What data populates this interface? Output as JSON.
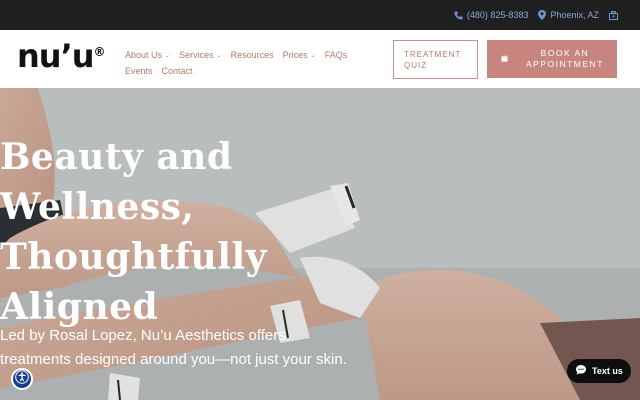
{
  "topbar": {
    "phone": "(480) 825-8383",
    "location": "Phoenix, AZ"
  },
  "brand": {
    "logo": "nu’u"
  },
  "nav": {
    "items": [
      {
        "label": "About Us",
        "has_dropdown": true
      },
      {
        "label": "Services",
        "has_dropdown": true
      },
      {
        "label": "Resources",
        "has_dropdown": false
      },
      {
        "label": "Prices",
        "has_dropdown": true
      },
      {
        "label": "FAQs",
        "has_dropdown": false
      },
      {
        "label": "Events",
        "has_dropdown": false
      },
      {
        "label": "Contact",
        "has_dropdown": false
      }
    ]
  },
  "cta": {
    "quiz_line1": "TREATMENT",
    "quiz_line2": "QUIZ",
    "book_line1": "BOOK AN",
    "book_line2": "APPOINTMENT"
  },
  "hero": {
    "headline_line1": "Beauty and Wellness,",
    "headline_line2": "Thoughtfully Aligned",
    "subtext": "Led by Rosal Lopez, Nu’u Aesthetics offers treatments designed around you—not just your skin."
  },
  "widgets": {
    "chat_label": "Text us",
    "accessibility_icon": "accessibility-icon"
  },
  "colors": {
    "topbar_bg": "#1f1f1f",
    "topbar_text": "#8aa8d8",
    "accent": "#c88580",
    "nav_text": "#b07a6e"
  }
}
